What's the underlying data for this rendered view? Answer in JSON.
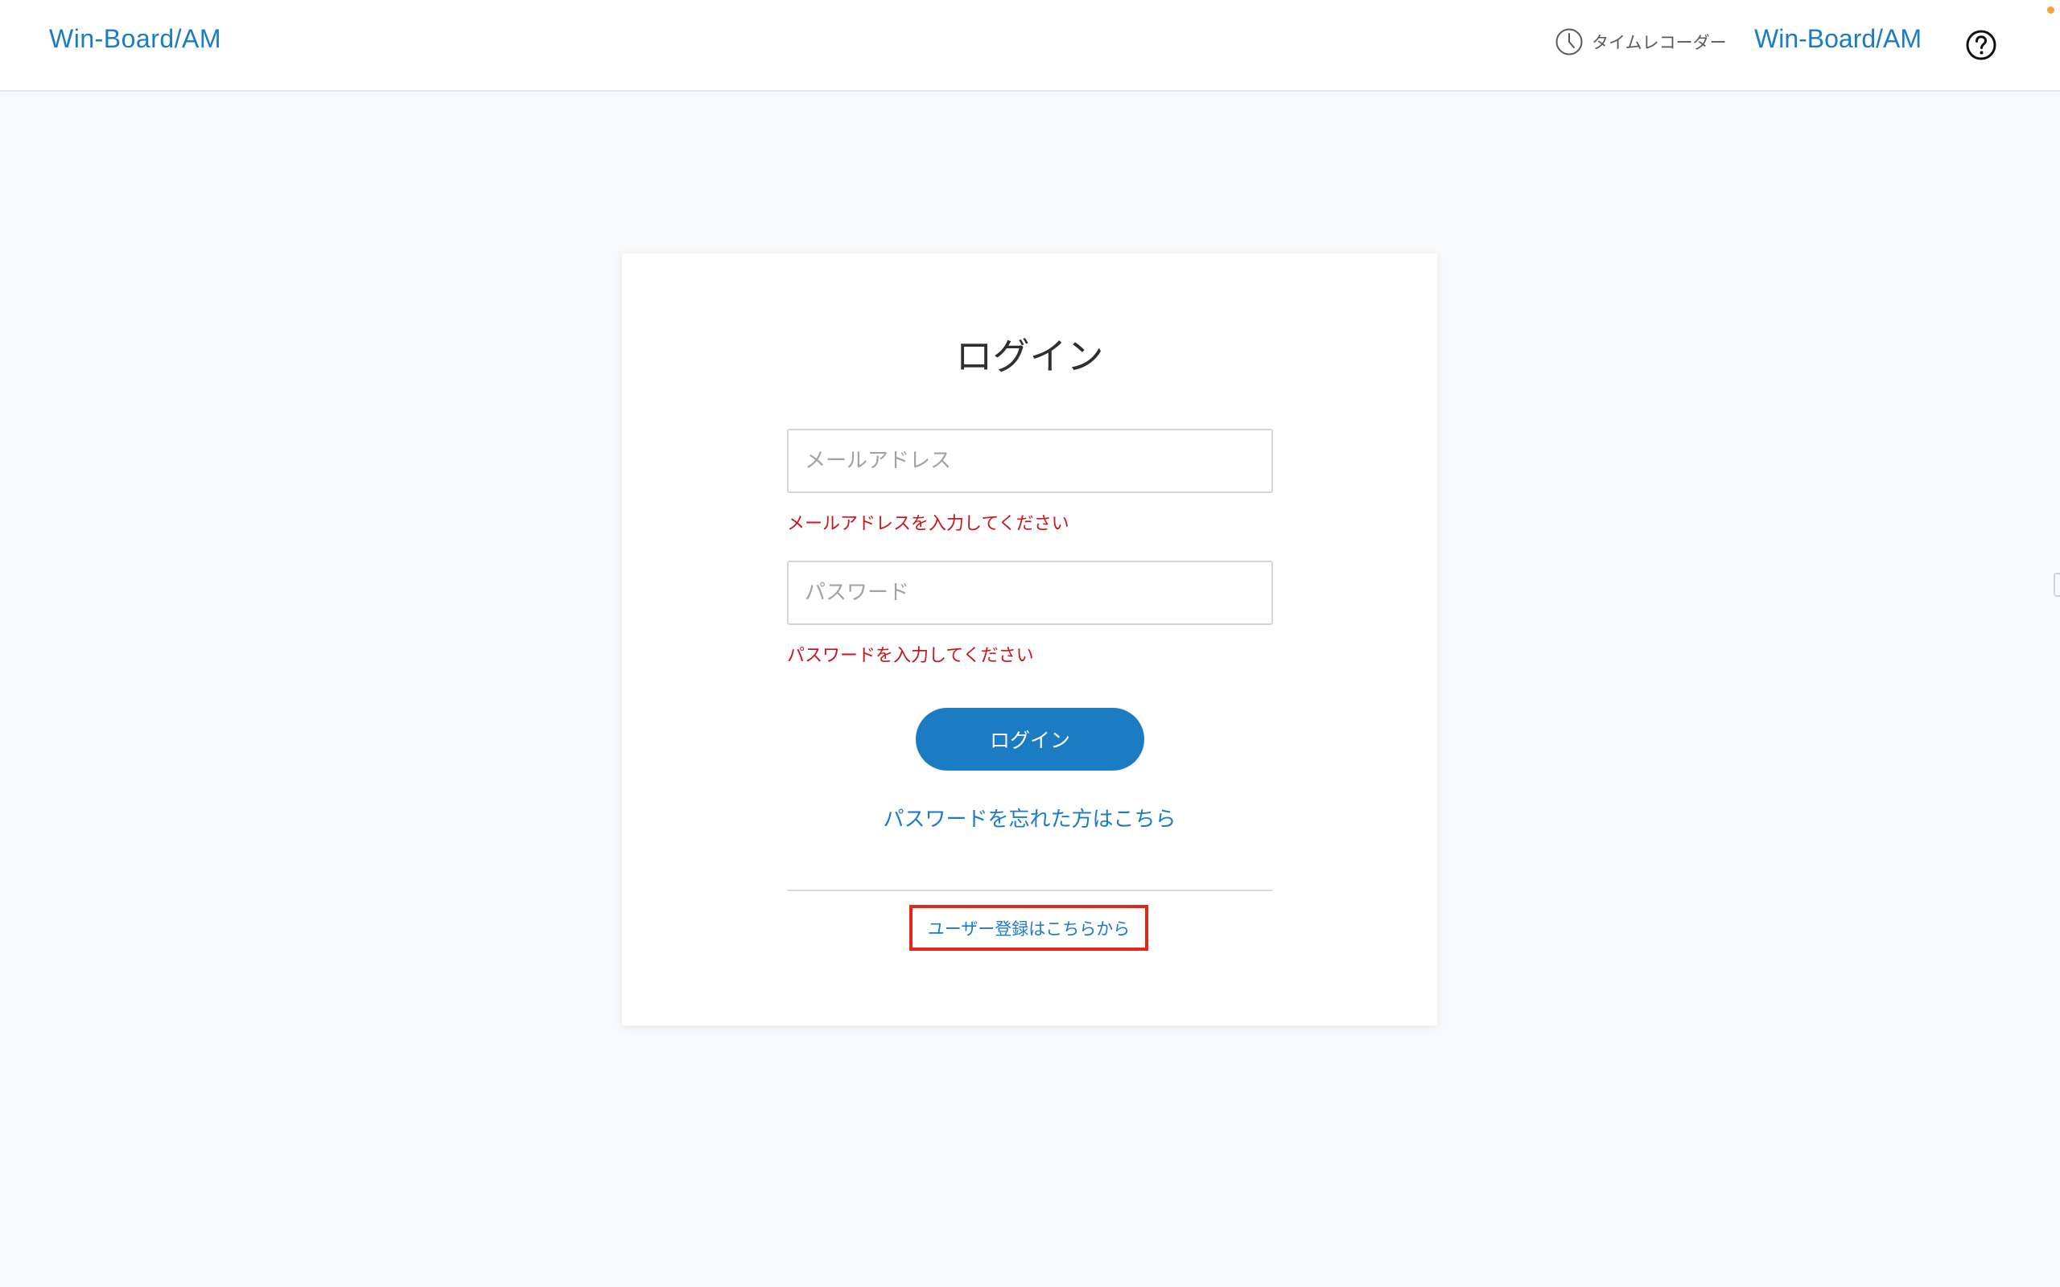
{
  "header": {
    "brand_left": "Win-Board/AM",
    "time_recorder_label": "タイムレコーダー",
    "brand_right": "Win-Board/AM",
    "icons": [
      "clock-icon",
      "help-icon"
    ]
  },
  "login": {
    "title": "ログイン",
    "email_placeholder": "メールアドレス",
    "email_value": "",
    "email_error": "メールアドレスを入力してください",
    "password_placeholder": "パスワード",
    "password_value": "",
    "password_error": "パスワードを入力してください",
    "login_button": "ログイン",
    "forgot_password": "パスワードを忘れた方はこちら",
    "register": "ユーザー登録はこちらから"
  },
  "colors": {
    "accent": "#1b7cc4",
    "error": "#c8161d",
    "highlight_box": "#e2261c",
    "background": "#f8f9fb"
  }
}
